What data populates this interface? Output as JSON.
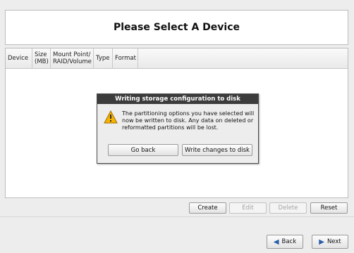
{
  "header": {
    "title": "Please Select A Device"
  },
  "table": {
    "columns": [
      {
        "line1": "Device",
        "line2": ""
      },
      {
        "line1": "Size",
        "line2": "(MB)"
      },
      {
        "line1": "Mount Point/",
        "line2": "RAID/Volume"
      },
      {
        "line1": "Type",
        "line2": ""
      },
      {
        "line1": "Format",
        "line2": ""
      }
    ]
  },
  "dialog": {
    "title": "Writing storage configuration to disk",
    "message": "The partitioning options you have selected will now be written to disk.  Any data on deleted or reformatted partitions will be lost.",
    "go_back_label": "Go back",
    "write_label": "Write changes to disk",
    "icon": "warning-icon"
  },
  "toolbar": {
    "create": "Create",
    "edit": "Edit",
    "delete": "Delete",
    "reset": "Reset"
  },
  "nav": {
    "back": "Back",
    "next": "Next"
  }
}
